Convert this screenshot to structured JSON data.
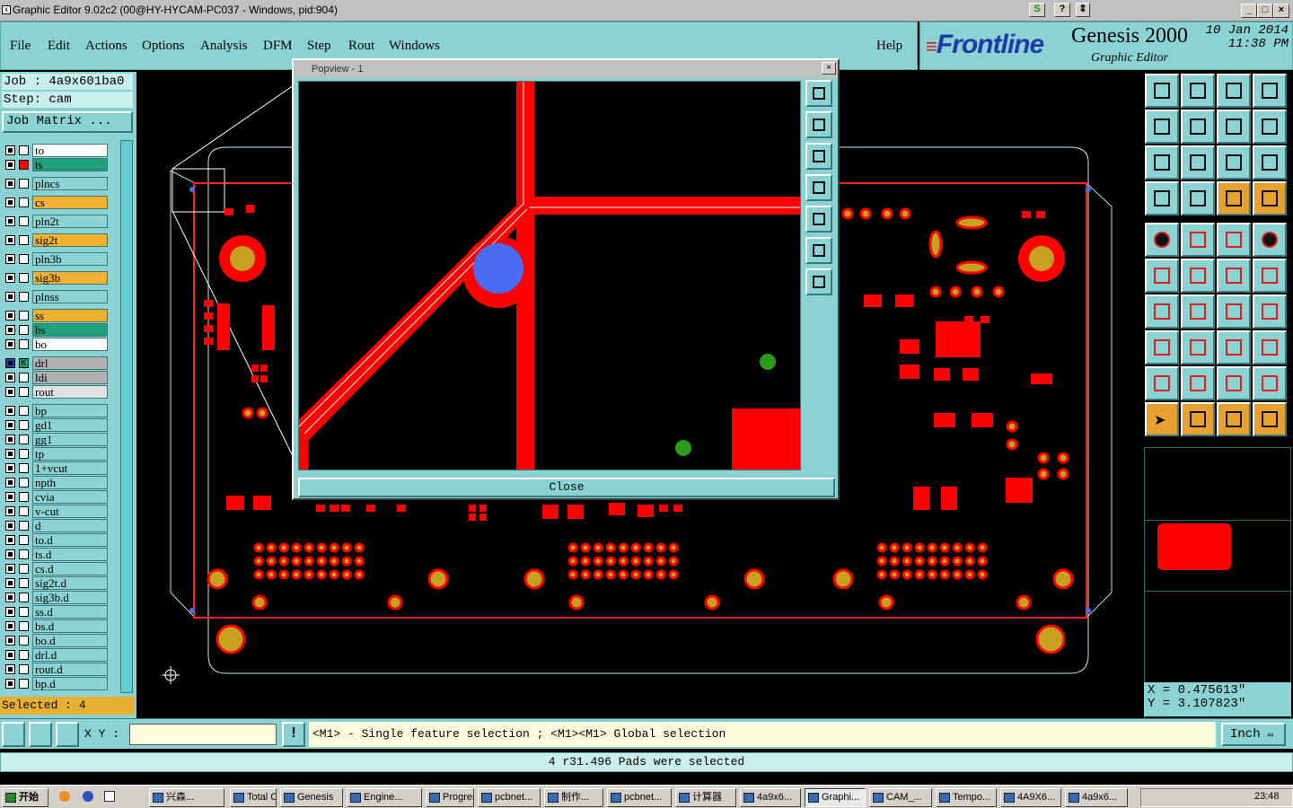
{
  "window": {
    "title": "Graphic Editor 9.02c2 (00@HY-HYCAM-PC037 - Windows, pid:904)"
  },
  "menu": [
    "File",
    "Edit",
    "Actions",
    "Options",
    "Analysis",
    "DFM",
    "Step",
    "Rout",
    "Windows"
  ],
  "help": "Help",
  "brand": {
    "logo_prefix": "F",
    "logo_rest": "rontline",
    "product": "Genesis 2000",
    "subtitle": "Graphic Editor",
    "date": "10 Jan 2014",
    "time": "11:38 PM"
  },
  "job": {
    "job": "Job : 4a9x601ba0",
    "step": "Step: cam",
    "matrix_button": "Job Matrix ..."
  },
  "layers": [
    {
      "name": "to",
      "color": "#ffffff"
    },
    {
      "name": "ts",
      "color": "#1fa07a"
    },
    {
      "name": "plncs",
      "color": "#8bd3d3"
    },
    {
      "name": "cs",
      "color": "#f0b030"
    },
    {
      "name": "pln2t",
      "color": "#8bd3d3"
    },
    {
      "name": "sig2t",
      "color": "#f0b030"
    },
    {
      "name": "pln3b",
      "color": "#8bd3d3"
    },
    {
      "name": "sig3b",
      "color": "#f0b030"
    },
    {
      "name": "plnss",
      "color": "#8bd3d3"
    },
    {
      "name": "ss",
      "color": "#f0b030"
    },
    {
      "name": "bs",
      "color": "#1fa07a"
    },
    {
      "name": "bo",
      "color": "#ffffff"
    },
    {
      "name": "drl",
      "color": "#b0b0b0"
    },
    {
      "name": "ldi",
      "color": "#b0b0b0"
    },
    {
      "name": "rout",
      "color": "#e0e0e0"
    },
    {
      "name": "bp",
      "color": "#8bd3d3"
    },
    {
      "name": "gd1",
      "color": "#8bd3d3"
    },
    {
      "name": "gg1",
      "color": "#8bd3d3"
    },
    {
      "name": "tp",
      "color": "#8bd3d3"
    },
    {
      "name": "1+vcut",
      "color": "#8bd3d3"
    },
    {
      "name": "npth",
      "color": "#8bd3d3"
    },
    {
      "name": "cvia",
      "color": "#8bd3d3"
    },
    {
      "name": "v-cut",
      "color": "#8bd3d3"
    },
    {
      "name": "d",
      "color": "#8bd3d3"
    },
    {
      "name": "to.d",
      "color": "#8bd3d3"
    },
    {
      "name": "ts.d",
      "color": "#8bd3d3"
    },
    {
      "name": "cs.d",
      "color": "#8bd3d3"
    },
    {
      "name": "sig2t.d",
      "color": "#8bd3d3"
    },
    {
      "name": "sig3b.d",
      "color": "#8bd3d3"
    },
    {
      "name": "ss.d",
      "color": "#8bd3d3"
    },
    {
      "name": "bs.d",
      "color": "#8bd3d3"
    },
    {
      "name": "bo.d",
      "color": "#8bd3d3"
    },
    {
      "name": "drl.d",
      "color": "#8bd3d3"
    },
    {
      "name": "rout.d",
      "color": "#8bd3d3"
    },
    {
      "name": "bp.d",
      "color": "#8bd3d3"
    }
  ],
  "selected": "Selected : 4",
  "popup": {
    "title": "Popview - 1",
    "close": "Close"
  },
  "coords": {
    "x": "X = 0.475613\"",
    "y": "Y = 3.107823\""
  },
  "bottom": {
    "xy_label": "X Y :",
    "xy_value": "",
    "message": "<M1> - Single feature selection ; <M1><M1> Global selection",
    "units": "Inch"
  },
  "status": "4 r31.496 Pads were selected",
  "taskbar": {
    "start": "开始",
    "items": [
      "兴森...",
      "Total C...",
      "Genesis",
      "Engine...",
      "Progress",
      "pcbnet...",
      "制作...",
      "pcbnet...",
      "计算器",
      "4a9x6...",
      "Graphi...",
      "CAM_...",
      "Tempo...",
      "4A9X6...",
      "4a9x6..."
    ],
    "clock": "23:48"
  },
  "colors": {
    "panel": "#8bd3d3",
    "copper": "#ff0000",
    "pad": "#c8a020",
    "drill_blue": "#4a6cf0",
    "accent": "#e8a030"
  }
}
